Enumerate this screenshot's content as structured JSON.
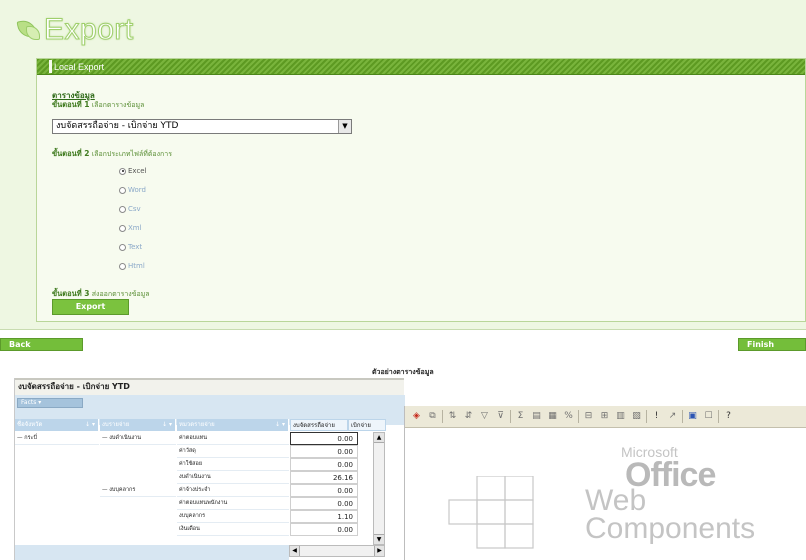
{
  "header": {
    "title": "Export"
  },
  "section": {
    "label": "Local Export"
  },
  "form": {
    "link_label": "ตารางข้อมูล",
    "step1_prefix": "ขั้นตอนที่ 1",
    "step1_text": "เลือกตารางข้อมูล",
    "selected_table": "งบจัดสรรถือจ่าย - เบิกจ่าย YTD",
    "step2_prefix": "ขั้นตอนที่ 2",
    "step2_text": "เลือกประเภทไฟล์ที่ต้องการ",
    "formats": [
      {
        "label": "Excel",
        "selected": true
      },
      {
        "label": "Word",
        "selected": false
      },
      {
        "label": "Csv",
        "selected": false
      },
      {
        "label": "Xml",
        "selected": false
      },
      {
        "label": "Text",
        "selected": false
      },
      {
        "label": "Html",
        "selected": false
      }
    ],
    "step3_prefix": "ขั้นตอนที่ 3",
    "step3_text": "ส่งออกตารางข้อมูล",
    "export_label": "Export"
  },
  "nav": {
    "back_label": "Back",
    "finish_label": "Finish"
  },
  "preview": {
    "title": "ตัวอย่างตารางข้อมูล",
    "pivot_title": "งบจัดสรรถือจ่าย - เบิกจ่าย YTD",
    "filter_chip": "Facts",
    "headers": {
      "col1": "ชื่อจังหวัด",
      "col2": "งบรายจ่าย",
      "col3": "หมวดรายจ่าย",
      "val1": "งบจัดสรรถือจ่าย",
      "val2": "เบิกจ่าย"
    },
    "rows": [
      {
        "province": "กระบี่",
        "budget": "งบดำเนินงาน",
        "category": "ค่าตอบแทน",
        "value": "0.00"
      },
      {
        "province": "",
        "budget": "",
        "category": "ค่าวัสดุ",
        "value": "0.00"
      },
      {
        "province": "",
        "budget": "",
        "category": "ค่าใช้สอย",
        "value": "0.00"
      },
      {
        "province": "",
        "budget": "",
        "category": "งบดำเนินงาน",
        "value": "26.16"
      },
      {
        "province": "",
        "budget": "งบบุคลากร",
        "category": "ค่าจ้างประจำ",
        "value": "0.00"
      },
      {
        "province": "",
        "budget": "",
        "category": "ค่าตอบแทนพนักงาน",
        "value": "0.00"
      },
      {
        "province": "",
        "budget": "",
        "category": "งบบุคลากร",
        "value": "1.10"
      },
      {
        "province": "",
        "budget": "",
        "category": "เงินเดือน",
        "value": "0.00"
      }
    ]
  },
  "owc": {
    "logo_microsoft": "Microsoft",
    "logo_office": "Office",
    "logo_web": "Web",
    "logo_components": "Components"
  }
}
